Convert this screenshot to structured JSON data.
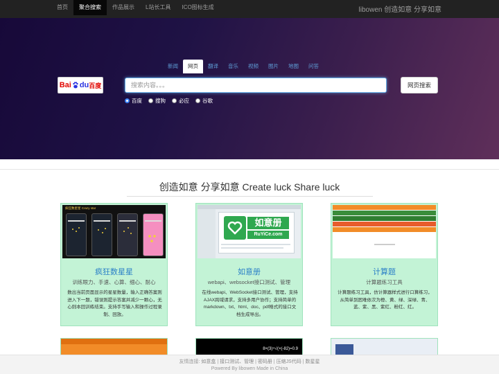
{
  "nav": {
    "links": [
      {
        "label": "首页",
        "active": false
      },
      {
        "label": "聚合搜索",
        "active": true
      },
      {
        "label": "作品展示",
        "active": false
      },
      {
        "label": "L站长工具",
        "active": false
      },
      {
        "label": "ICO图标生成",
        "active": false
      }
    ],
    "brand": "libowen 创造如意 分享如意"
  },
  "search": {
    "tabs": [
      {
        "label": "新闻",
        "active": false
      },
      {
        "label": "网页",
        "active": true
      },
      {
        "label": "翻译",
        "active": false
      },
      {
        "label": "音乐",
        "active": false
      },
      {
        "label": "视频",
        "active": false
      },
      {
        "label": "图片",
        "active": false
      },
      {
        "label": "地图",
        "active": false
      },
      {
        "label": "问答",
        "active": false
      }
    ],
    "logo_part1": "Bai",
    "logo_part2": "du",
    "logo_part3": "百度",
    "placeholder": "搜索内容。。。",
    "button_label": "网页搜索",
    "engines": [
      {
        "label": "百度",
        "checked": true
      },
      {
        "label": "搜狗",
        "checked": false
      },
      {
        "label": "必应",
        "checked": false
      },
      {
        "label": "谷歌",
        "checked": false
      }
    ]
  },
  "headline": "创造如意 分享如意 Create luck Share luck",
  "cards": [
    {
      "title": "疯狂数星星",
      "subtitle": "训练眼力、手速、心算、细心、耐心",
      "desc": "数出当前页面显示的星星数量，输入正确答案则进入下一题，错误则提示答案并减少一颗心，无心则本回训练结束。支持手写输入和操作过程录制、回放。",
      "thumb_header": "疯狂数星星 Crazy star"
    },
    {
      "title": "如意册",
      "subtitle": "webapi、websocket接口测试、管理",
      "desc": "在线webapi、WebSocket接口测试、管理，支持AJAX跨域请求，支持多用户协作；支持简单的markdown、txt、html、doc、pdf格式的接口文档生成导出。",
      "thumb_logo": "如意册",
      "thumb_logo_sub": "RuYiCe.com"
    },
    {
      "title": "计算题",
      "subtitle": "计算题练习工具",
      "desc": "计算题练习工具，仿计算器样式进行口算练习，从简单到困难依次为橙、黄、绿、深绿、青、蓝、紫、黑、紫红、粉红、红。"
    }
  ],
  "card2_row": {
    "second_formula": "8×(3)÷√(×(-82)=0.9"
  },
  "footer": {
    "friend_label": "友情连接:",
    "links": [
      "如意盒",
      "接口测试、管理",
      "密码册",
      "压缩JS代码",
      "数星星"
    ],
    "powered": "Powered By libowen Made in China"
  },
  "colors": {
    "accent": "#2a7fc7",
    "card_bg": "#c3f3d6",
    "nav_bg": "#222222"
  }
}
